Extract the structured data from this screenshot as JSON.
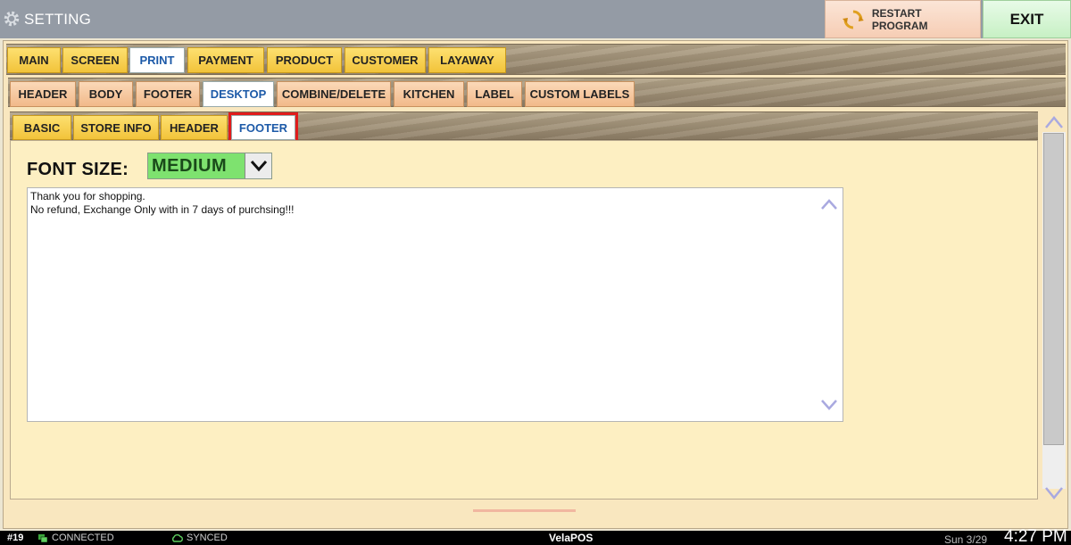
{
  "title_bar": {
    "title": "SETTING",
    "restart_label": "RESTART PROGRAM",
    "exit_label": "EXIT"
  },
  "tabs_main": [
    {
      "label": "MAIN"
    },
    {
      "label": "SCREEN"
    },
    {
      "label": "PRINT"
    },
    {
      "label": "PAYMENT"
    },
    {
      "label": "PRODUCT"
    },
    {
      "label": "CUSTOMER"
    },
    {
      "label": "LAYAWAY"
    }
  ],
  "tabs_print": [
    {
      "label": "HEADER"
    },
    {
      "label": "BODY"
    },
    {
      "label": "FOOTER"
    },
    {
      "label": "DESKTOP"
    },
    {
      "label": "COMBINE/DELETE"
    },
    {
      "label": "KITCHEN"
    },
    {
      "label": "LABEL"
    },
    {
      "label": "CUSTOM LABELS"
    }
  ],
  "tabs_desktop": [
    {
      "label": "BASIC"
    },
    {
      "label": "STORE INFO"
    },
    {
      "label": "HEADER"
    },
    {
      "label": "FOOTER"
    }
  ],
  "font_size": {
    "label": "FONT SIZE:",
    "value": "MEDIUM"
  },
  "footer_text": {
    "lines": [
      "Thank you for shopping.",
      "No refund, Exchange Only with in 7 days of purchsing!!!"
    ]
  },
  "status_bar": {
    "station": "#19",
    "connection": "CONNECTED",
    "sync": "SYNCED",
    "app": "VelaPOS",
    "date": "Sun 3/29",
    "time": "4:27 PM"
  },
  "colors": {
    "highlight_border": "#e01b1b",
    "font_size_value_bg": "#7ee26f",
    "active_tab_text": "#1d5aa8"
  }
}
